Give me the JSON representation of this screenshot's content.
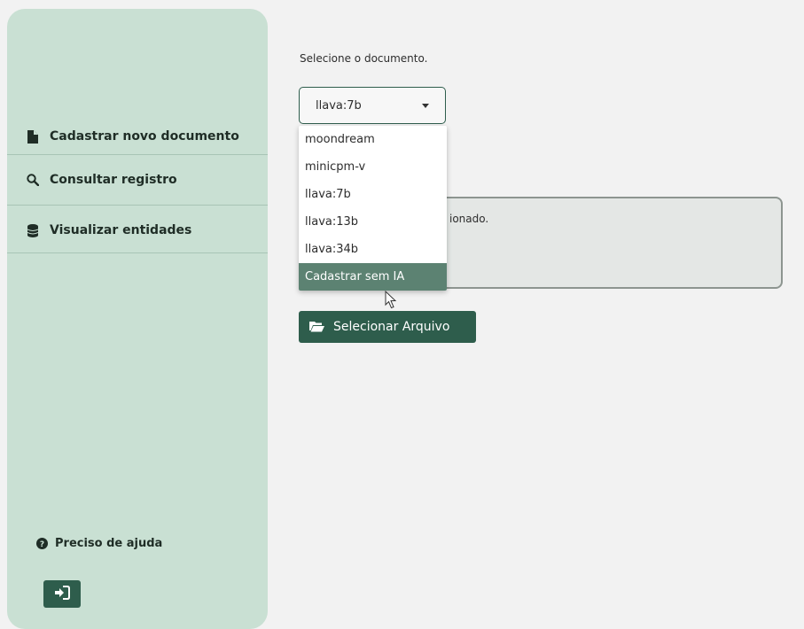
{
  "sidebar": {
    "items": [
      {
        "label": "Cadastrar novo documento",
        "icon": "file-icon"
      },
      {
        "label": "Consultar registro",
        "icon": "search-icon"
      },
      {
        "label": "Visualizar entidades",
        "icon": "database-icon"
      }
    ],
    "help_label": "Preciso de ajuda",
    "help_icon": "question-circle-icon",
    "logout_icon": "sign-out-icon"
  },
  "main": {
    "prompt": "Selecione o documento.",
    "model_select": {
      "value": "llava:7b",
      "options": [
        "moondream",
        "minicpm-v",
        "llava:7b",
        "llava:13b",
        "llava:34b",
        "Cadastrar sem IA"
      ],
      "highlighted": "Cadastrar sem IA"
    },
    "status_partial": "ionado.",
    "file_button_label": "Selecionar Arquivo",
    "file_button_icon": "folder-open-icon"
  },
  "colors": {
    "sidebar_bg": "#c9e0d3",
    "accent": "#2e5d4c",
    "highlight": "#5c8272",
    "page_bg": "#f2f2f2"
  }
}
